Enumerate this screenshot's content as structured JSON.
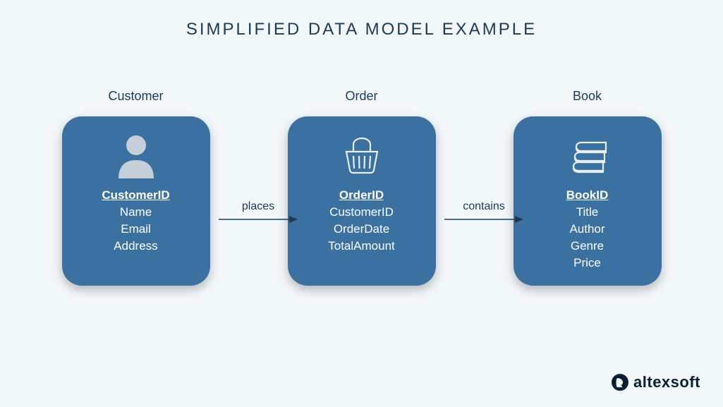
{
  "title": "SIMPLIFIED DATA MODEL EXAMPLE",
  "entities": [
    {
      "label": "Customer",
      "icon": "person-icon",
      "attributes": [
        {
          "name": "CustomerID",
          "primary": true
        },
        {
          "name": "Name",
          "primary": false
        },
        {
          "name": "Email",
          "primary": false
        },
        {
          "name": "Address",
          "primary": false
        }
      ]
    },
    {
      "label": "Order",
      "icon": "basket-icon",
      "attributes": [
        {
          "name": "OrderID",
          "primary": true
        },
        {
          "name": "CustomerID",
          "primary": false
        },
        {
          "name": "OrderDate",
          "primary": false
        },
        {
          "name": "TotalAmount",
          "primary": false
        }
      ]
    },
    {
      "label": "Book",
      "icon": "books-icon",
      "attributes": [
        {
          "name": "BookID",
          "primary": true
        },
        {
          "name": "Title",
          "primary": false
        },
        {
          "name": "Author",
          "primary": false
        },
        {
          "name": "Genre",
          "primary": false
        },
        {
          "name": "Price",
          "primary": false
        }
      ]
    }
  ],
  "relations": [
    {
      "label": "places"
    },
    {
      "label": "contains"
    }
  ],
  "brand": {
    "name": "altexsoft"
  },
  "colors": {
    "background": "#f2f7fa",
    "box": "#3a71a0",
    "text_dark": "#1e3a52",
    "text_light": "#ffffff",
    "icon_light": "#c4cfd9"
  }
}
